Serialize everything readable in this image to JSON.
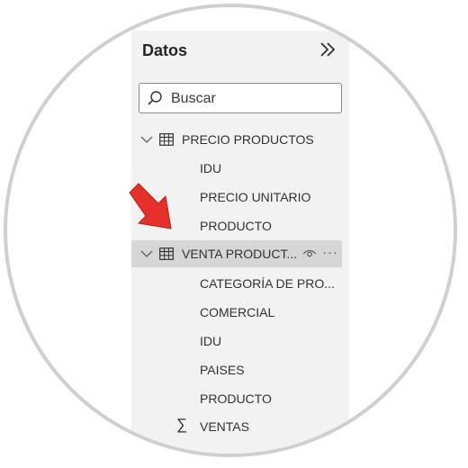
{
  "panel": {
    "title": "Datos",
    "search_placeholder": "Buscar"
  },
  "tables": [
    {
      "name": "PRECIO PRODUCTOS",
      "expanded": true,
      "fields": [
        "IDU",
        "PRECIO UNITARIO",
        "PRODUCTO"
      ]
    },
    {
      "name": "VENTA PRODUCT...",
      "expanded": true,
      "selected": true,
      "fields": [
        "CATEGORÍA DE PRO...",
        "COMERCIAL",
        "IDU",
        "PAISES",
        "PRODUCTO"
      ],
      "measure": "VENTAS"
    }
  ],
  "annotation": {
    "arrow_color": "#e6302a"
  }
}
